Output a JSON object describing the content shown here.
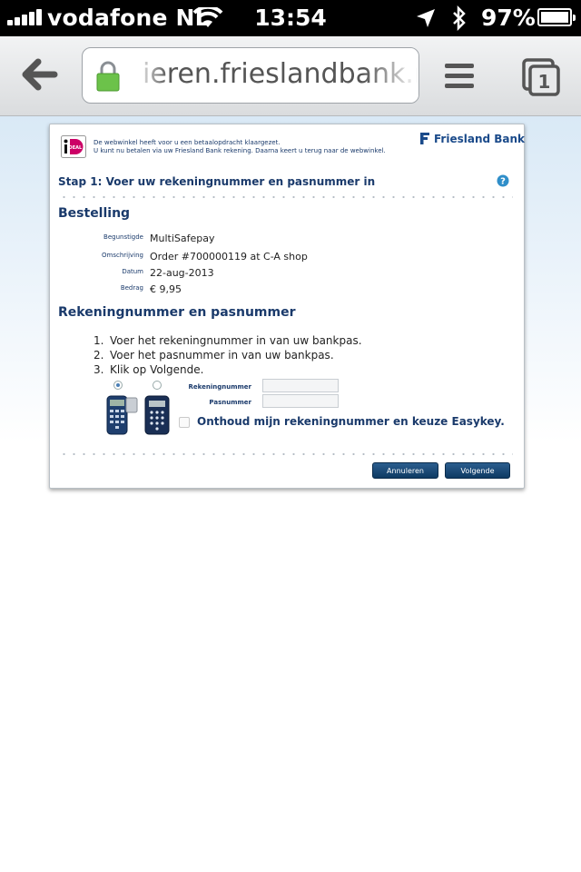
{
  "status_bar": {
    "carrier": "vodafone NL",
    "time": "13:54",
    "battery": "97%"
  },
  "browser": {
    "url": "ieren.frieslandbank.nl"
  },
  "ideal": {
    "notice_line1": "De webwinkel heeft voor u een betaalopdracht klaargezet.",
    "notice_line2": "U kunt nu betalen via uw Friesland Bank rekening. Daarna keert u terug naar de webwinkel.",
    "bank_name": "Friesland Bank",
    "step_title": "Stap 1: Voer uw rekeningnummer en pasnummer in",
    "order_section_title": "Bestelling",
    "order": [
      {
        "label": "Begunstigde",
        "value": "MultiSafepay"
      },
      {
        "label": "Omschrijving",
        "value": "Order #700000119 at C-A shop"
      },
      {
        "label": "Datum",
        "value": "22-aug-2013"
      },
      {
        "label": "Bedrag",
        "value": "€ 9,95"
      }
    ],
    "account_section_title": "Rekeningnummer en pasnummer",
    "steps": [
      {
        "num": "1.",
        "text": "Voer het rekeningnummer in van uw bankpas."
      },
      {
        "num": "2.",
        "text": "Voer het pasnummer in van uw bankpas."
      },
      {
        "num": "3.",
        "text": "Klik op Volgende."
      }
    ],
    "account_label": "Rekeningnummer",
    "card_label": "Pasnummer",
    "account_value": "",
    "card_value": "",
    "remember_label": "Onthoud mijn rekeningnummer en keuze Easykey.",
    "cancel_label": "Annuleren",
    "next_label": "Volgende",
    "selected_reader": 1
  }
}
